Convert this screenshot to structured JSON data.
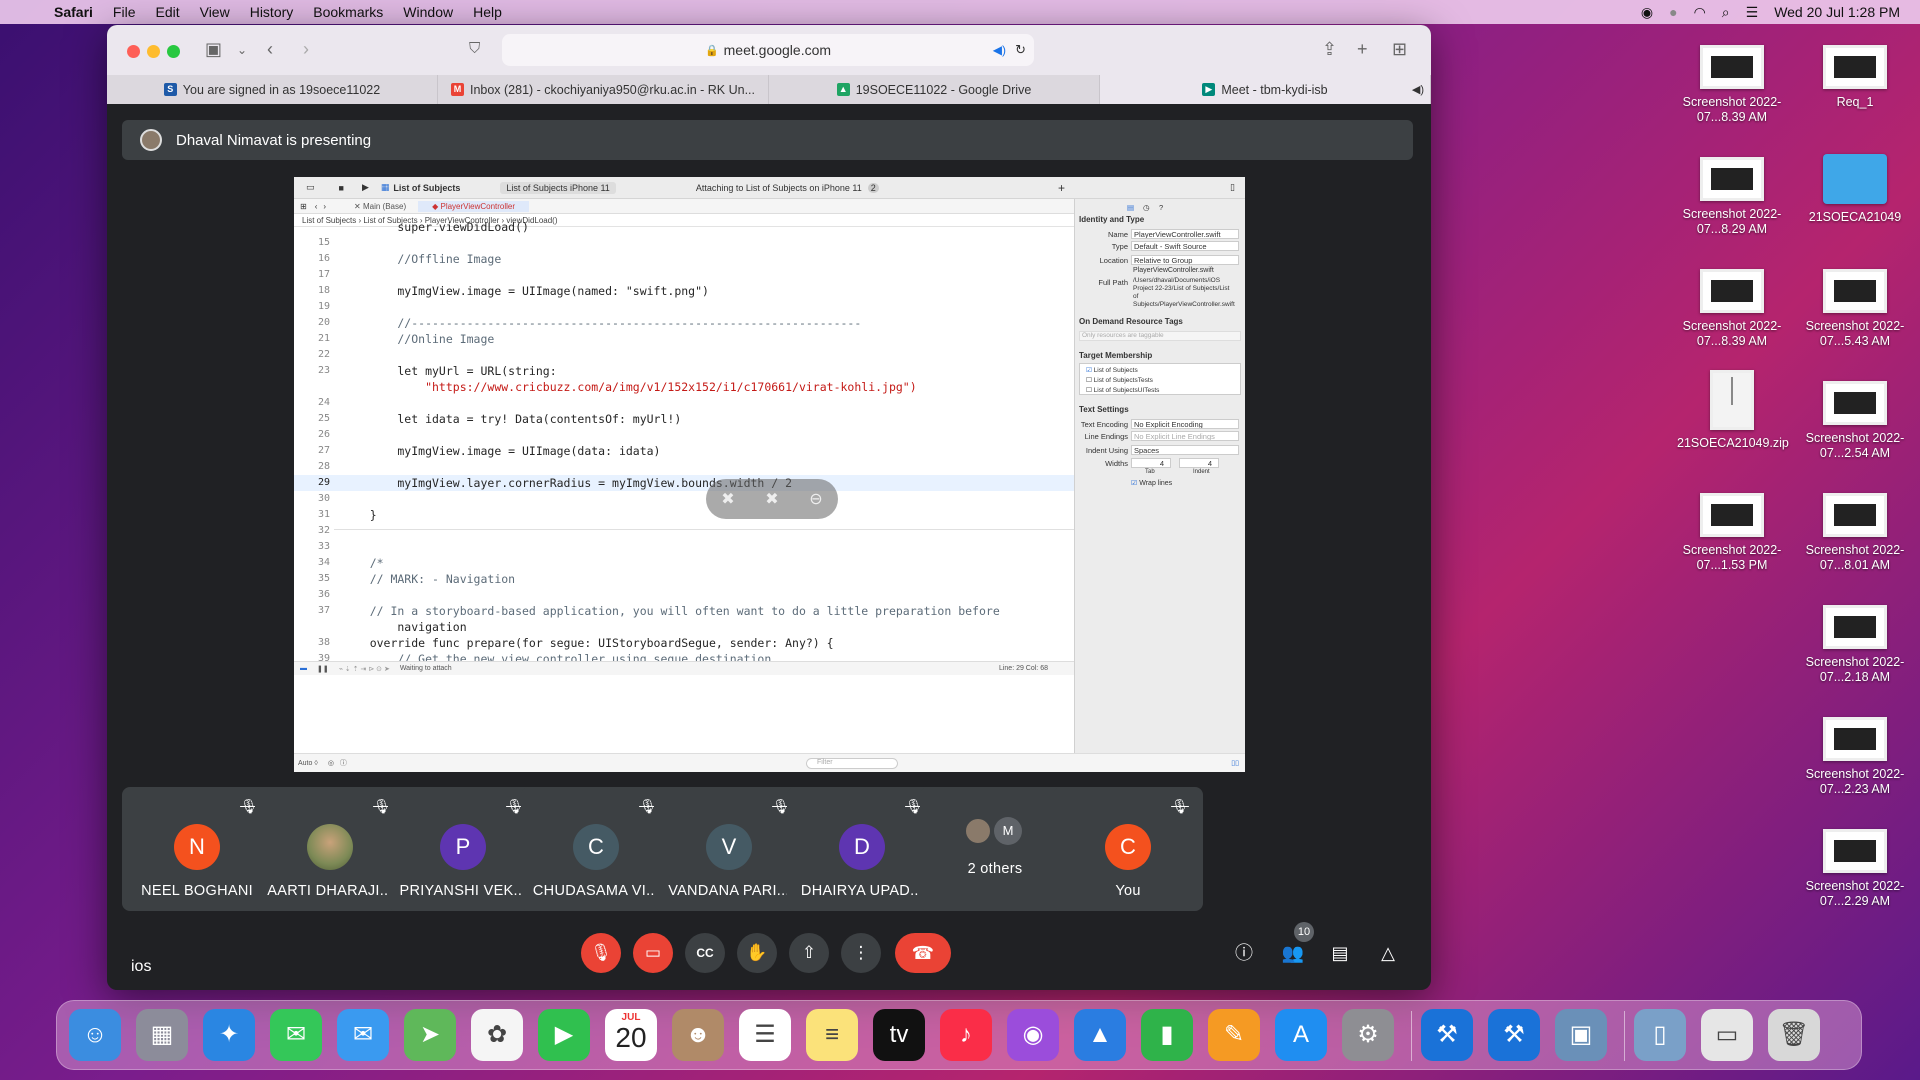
{
  "menubar": {
    "app": "Safari",
    "items": [
      "File",
      "Edit",
      "View",
      "History",
      "Bookmarks",
      "Window",
      "Help"
    ],
    "clock": "Wed 20 Jul  1:28 PM"
  },
  "browser": {
    "url": "meet.google.com",
    "tabs": [
      {
        "label": "You are signed in as 19soece11022",
        "favicon_color": "#1e5aa8",
        "favicon_text": "S"
      },
      {
        "label": "Inbox (281) - ckochiyaniya950@rku.ac.in - RK Un...",
        "favicon_color": "#ea4335",
        "favicon_text": "M"
      },
      {
        "label": "19SOECE11022 - Google Drive",
        "favicon_color": "#1fa463",
        "favicon_text": "▲"
      },
      {
        "label": "Meet - tbm-kydi-isb",
        "favicon_color": "#00897b",
        "favicon_text": "▶"
      }
    ]
  },
  "meet": {
    "presenting_text": "Dhaval Nimavat is presenting",
    "meeting_name": "ios",
    "participants_count": "10",
    "participants": [
      {
        "initial": "N",
        "name": "NEEL BOGHANI",
        "color": "#f4511e"
      },
      {
        "initial": "",
        "name": "AARTI DHARAJI...",
        "color": "#7a8a5a"
      },
      {
        "initial": "P",
        "name": "PRIYANSHI VEK...",
        "color": "#5e35b1"
      },
      {
        "initial": "C",
        "name": "CHUDASAMA VI...",
        "color": "#455a64"
      },
      {
        "initial": "V",
        "name": "VANDANA PARI...",
        "color": "#455a64"
      },
      {
        "initial": "D",
        "name": "DHAIRYA UPAD...",
        "color": "#5e35b1"
      },
      {
        "initial": "M",
        "name": "2 others",
        "color": "#3c4043"
      },
      {
        "initial": "C",
        "name": "You",
        "color": "#f4511e"
      }
    ]
  },
  "xcode": {
    "scheme": "List of Subjects",
    "target_path": "List of Subjects  iPhone 11",
    "status": "Attaching to List of Subjects on iPhone 11",
    "status_count": "2",
    "tab1": "Main (Base)",
    "tab2": "PlayerViewController",
    "breadcrumb": "List of Subjects  ›  List of Subjects  ›  PlayerViewController  ›  viewDidLoad()",
    "debug_status": "Waiting to attach",
    "cursor_pos": "Line: 29  Col: 68",
    "bottom_left": "Auto ◊",
    "filter_placeholder": "Filter",
    "code_lines": [
      {
        "n": "",
        "t": "        super.viewDidLoad()"
      },
      {
        "n": "15",
        "t": ""
      },
      {
        "n": "16",
        "t": "        //Offline Image"
      },
      {
        "n": "17",
        "t": ""
      },
      {
        "n": "18",
        "t": "        myImgView.image = UIImage(named: \"swift.png\")"
      },
      {
        "n": "19",
        "t": ""
      },
      {
        "n": "20",
        "t": "        //-----------------------------------------------------------------"
      },
      {
        "n": "21",
        "t": "        //Online Image"
      },
      {
        "n": "22",
        "t": ""
      },
      {
        "n": "23",
        "t": "        let myUrl = URL(string:"
      },
      {
        "n": "",
        "t": "            \"https://www.cricbuzz.com/a/img/v1/152x152/i1/c170661/virat-kohli.jpg\")"
      },
      {
        "n": "24",
        "t": ""
      },
      {
        "n": "25",
        "t": "        let idata = try! Data(contentsOf: myUrl!)"
      },
      {
        "n": "26",
        "t": ""
      },
      {
        "n": "27",
        "t": "        myImgView.image = UIImage(data: idata)"
      },
      {
        "n": "28",
        "t": ""
      },
      {
        "n": "29",
        "t": "        myImgView.layer.cornerRadius = myImgView.bounds.width / 2"
      },
      {
        "n": "30",
        "t": ""
      },
      {
        "n": "31",
        "t": "    }"
      },
      {
        "n": "32",
        "t": ""
      },
      {
        "n": "33",
        "t": ""
      },
      {
        "n": "34",
        "t": "    /*"
      },
      {
        "n": "35",
        "t": "    // MARK: - Navigation"
      },
      {
        "n": "36",
        "t": ""
      },
      {
        "n": "37",
        "t": "    // In a storyboard-based application, you will often want to do a little preparation before"
      },
      {
        "n": "",
        "t": "        navigation"
      },
      {
        "n": "38",
        "t": "    override func prepare(for segue: UIStoryboardSegue, sender: Any?) {"
      },
      {
        "n": "39",
        "t": "        // Get the new view controller using segue.destination."
      }
    ],
    "inspector": {
      "identity_title": "Identity and Type",
      "name_label": "Name",
      "name_value": "PlayerViewController.swift",
      "type_label": "Type",
      "type_value": "Default - Swift Source",
      "location_label": "Location",
      "location_value": "Relative to Group",
      "location_file": "PlayerViewController.swift",
      "fullpath_label": "Full Path",
      "fullpath_value": "/Users/dhaval/Documents/iOS Project 22-23/List of Subjects/List of Subjects/PlayerViewController.swift",
      "ondemand_title": "On Demand Resource Tags",
      "ondemand_placeholder": "Only resources are taggable",
      "target_title": "Target Membership",
      "targets": [
        "List of Subjects",
        "List of SubjectsTests",
        "List of SubjectsUITests"
      ],
      "text_title": "Text Settings",
      "encoding_label": "Text Encoding",
      "encoding_value": "No Explicit Encoding",
      "endings_label": "Line Endings",
      "endings_value": "No Explicit Line Endings",
      "indent_label": "Indent Using",
      "indent_value": "Spaces",
      "widths_label": "Widths",
      "tab_value": "4",
      "indent_value2": "4",
      "tab_label": "Tab",
      "indent_label2": "Indent",
      "wrap_label": "Wrap lines"
    }
  },
  "desktop": {
    "icons": [
      {
        "label": "Screenshot 2022-07...8.39 AM",
        "kind": "shot"
      },
      {
        "label": "Req_1",
        "kind": "shot"
      },
      {
        "label": "Screenshot 2022-07...8.29 AM",
        "kind": "shot"
      },
      {
        "label": "21SOECA21049",
        "kind": "folder"
      },
      {
        "label": "Screenshot 2022-07...8.39 AM",
        "kind": "shot"
      },
      {
        "label": "Screenshot 2022-07...5.43 AM",
        "kind": "shot"
      },
      {
        "label": "21SOECA21049.zip",
        "kind": "zip"
      },
      {
        "label": "Screenshot 2022-07...2.54 AM",
        "kind": "shot"
      },
      {
        "label": "Screenshot 2022-07...1.53 PM",
        "kind": "shot"
      },
      {
        "label": "Screenshot 2022-07...8.01 AM",
        "kind": "shot"
      },
      {
        "label": "Screenshot 2022-07...2.18 AM",
        "kind": "shot"
      },
      {
        "label": "Screenshot 2022-07...2.23 AM",
        "kind": "shot"
      },
      {
        "label": "Screenshot 2022-07...2.29 AM",
        "kind": "shot"
      }
    ]
  },
  "dock": {
    "calendar_month": "JUL",
    "calendar_day": "20",
    "apps": [
      {
        "name": "finder-icon",
        "color": "#3b8de0",
        "glyph": "☺"
      },
      {
        "name": "launchpad-icon",
        "color": "#8c8c9a",
        "glyph": "▦"
      },
      {
        "name": "safari-icon",
        "color": "#2a86e2",
        "glyph": "✦"
      },
      {
        "name": "messages-icon",
        "color": "#34c759",
        "glyph": "✉"
      },
      {
        "name": "mail-icon",
        "color": "#3a9af0",
        "glyph": "✉"
      },
      {
        "name": "maps-icon",
        "color": "#5fb85a",
        "glyph": "➤"
      },
      {
        "name": "photos-icon",
        "color": "#f5f5f5",
        "glyph": "✿"
      },
      {
        "name": "facetime-icon",
        "color": "#30c04f",
        "glyph": "▶"
      },
      {
        "name": "calendar-icon",
        "color": "#ffffff",
        "glyph": ""
      },
      {
        "name": "contacts-icon",
        "color": "#b08a68",
        "glyph": "☻"
      },
      {
        "name": "reminders-icon",
        "color": "#ffffff",
        "glyph": "☰"
      },
      {
        "name": "notes-icon",
        "color": "#fbe27a",
        "glyph": "≡"
      },
      {
        "name": "appletv-icon",
        "color": "#111111",
        "glyph": "tv"
      },
      {
        "name": "music-icon",
        "color": "#fa2d48",
        "glyph": "♪"
      },
      {
        "name": "podcasts-icon",
        "color": "#9b4ddb",
        "glyph": "◉"
      },
      {
        "name": "keynote-icon",
        "color": "#2a7de1",
        "glyph": "▲"
      },
      {
        "name": "numbers-icon",
        "color": "#2fb34a",
        "glyph": "▮"
      },
      {
        "name": "pages-icon",
        "color": "#f59a23",
        "glyph": "✎"
      },
      {
        "name": "appstore-icon",
        "color": "#1f8ef1",
        "glyph": "A"
      },
      {
        "name": "systemprefs-icon",
        "color": "#8e8e93",
        "glyph": "⚙"
      },
      {
        "name": "xcode-icon",
        "color": "#1a72d8",
        "glyph": "⚒"
      },
      {
        "name": "instruments-icon",
        "color": "#1a72d8",
        "glyph": "⚒"
      },
      {
        "name": "preview-icon",
        "color": "#6a90b8",
        "glyph": "▣"
      },
      {
        "name": "simulator-icon",
        "color": "#7aa0c8",
        "glyph": "▯"
      },
      {
        "name": "downloads-stack-icon",
        "color": "#e6e6e6",
        "glyph": "▭"
      },
      {
        "name": "trash-icon",
        "color": "#d8d8d8",
        "glyph": "🗑"
      }
    ]
  }
}
